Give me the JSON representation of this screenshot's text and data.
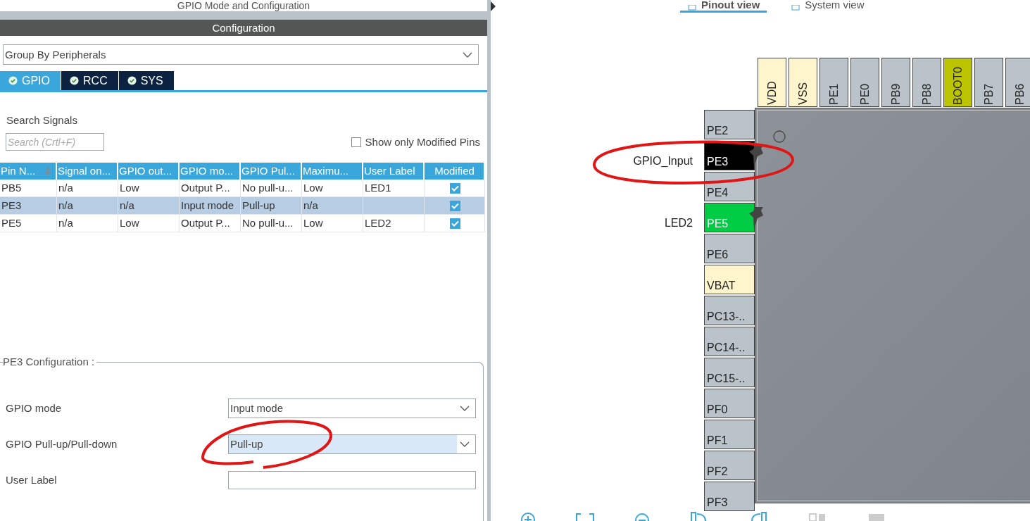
{
  "left_panel": {
    "title": "GPIO Mode and Configuration",
    "section_title": "Configuration",
    "group_select": {
      "value": "Group By Peripherals"
    },
    "tabs": [
      {
        "label": "GPIO",
        "selected": true
      },
      {
        "label": "RCC",
        "selected": false
      },
      {
        "label": "SYS",
        "selected": false
      }
    ],
    "search": {
      "label": "Search Signals",
      "placeholder": "Search (Crtl+F)"
    },
    "show_modified": {
      "label": "Show only Modified Pins",
      "checked": false
    },
    "table": {
      "columns": [
        "Pin N...",
        "Signal on...",
        "GPIO out...",
        "GPIO mo...",
        "GPIO Pul...",
        "Maximu...",
        "User Label",
        "Modified"
      ],
      "rows": [
        {
          "cells": [
            "PB5",
            "n/a",
            "Low",
            "Output P...",
            "No pull-u...",
            "Low",
            "LED1"
          ],
          "modified": true,
          "selected": false
        },
        {
          "cells": [
            "PE3",
            "n/a",
            "n/a",
            "Input mode",
            "Pull-up",
            "n/a",
            ""
          ],
          "modified": true,
          "selected": true
        },
        {
          "cells": [
            "PE5",
            "n/a",
            "Low",
            "Output P...",
            "No pull-u...",
            "Low",
            "LED2"
          ],
          "modified": true,
          "selected": false
        }
      ]
    },
    "pin_config": {
      "title": "PE3 Configuration :",
      "fields": [
        {
          "label": "GPIO mode",
          "kind": "select",
          "value": "Input mode",
          "highlighted": false
        },
        {
          "label": "GPIO Pull-up/Pull-down",
          "kind": "select",
          "value": "Pull-up",
          "highlighted": true
        },
        {
          "label": "User Label",
          "kind": "text"
        }
      ]
    }
  },
  "right_panel": {
    "tabs": [
      {
        "label": "Pinout view",
        "selected": true
      },
      {
        "label": "System view",
        "selected": false
      }
    ],
    "top_pins": [
      {
        "label": "VDD",
        "kind": "power"
      },
      {
        "label": "VSS",
        "kind": "power"
      },
      {
        "label": "PE1",
        "kind": "io"
      },
      {
        "label": "PE0",
        "kind": "io"
      },
      {
        "label": "PB9",
        "kind": "io"
      },
      {
        "label": "PB8",
        "kind": "io"
      },
      {
        "label": "BOOT0",
        "kind": "boot"
      },
      {
        "label": "PB7",
        "kind": "io"
      },
      {
        "label": "PB6",
        "kind": "io"
      }
    ],
    "left_pins": [
      {
        "label": "PE2",
        "kind": "io"
      },
      {
        "label": "PE3",
        "kind": "input",
        "signal": "GPIO_Input",
        "pinned": true
      },
      {
        "label": "PE4",
        "kind": "io"
      },
      {
        "label": "PE5",
        "kind": "output",
        "signal": "LED2",
        "pinned": true
      },
      {
        "label": "PE6",
        "kind": "io"
      },
      {
        "label": "VBAT",
        "kind": "power"
      },
      {
        "label": "PC13-..",
        "kind": "io"
      },
      {
        "label": "PC14-..",
        "kind": "io"
      },
      {
        "label": "PC15-..",
        "kind": "io"
      },
      {
        "label": "PF0",
        "kind": "io"
      },
      {
        "label": "PF1",
        "kind": "io"
      },
      {
        "label": "PF2",
        "kind": "io"
      },
      {
        "label": "PF3",
        "kind": "io"
      }
    ]
  }
}
